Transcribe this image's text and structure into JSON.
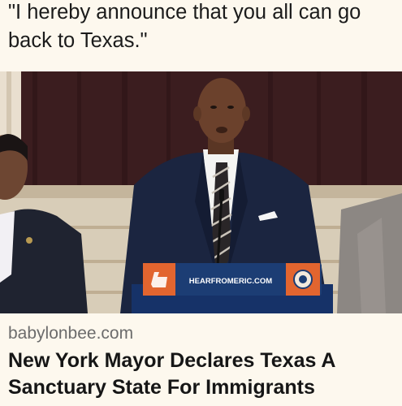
{
  "post": {
    "quote": "\"I hereby announce that you all can go back to Texas.\""
  },
  "photo": {
    "podium_sign": "HEARFROMERIC.COM"
  },
  "link_card": {
    "source": "babylonbee.com",
    "headline": "New York Mayor Declares Texas A Sanctuary State For Immigrants"
  },
  "colors": {
    "background": "#fdf8ee",
    "podium": "#1c3d74",
    "podium_accent": "#e2652f",
    "curtain": "#3b1d1f"
  }
}
